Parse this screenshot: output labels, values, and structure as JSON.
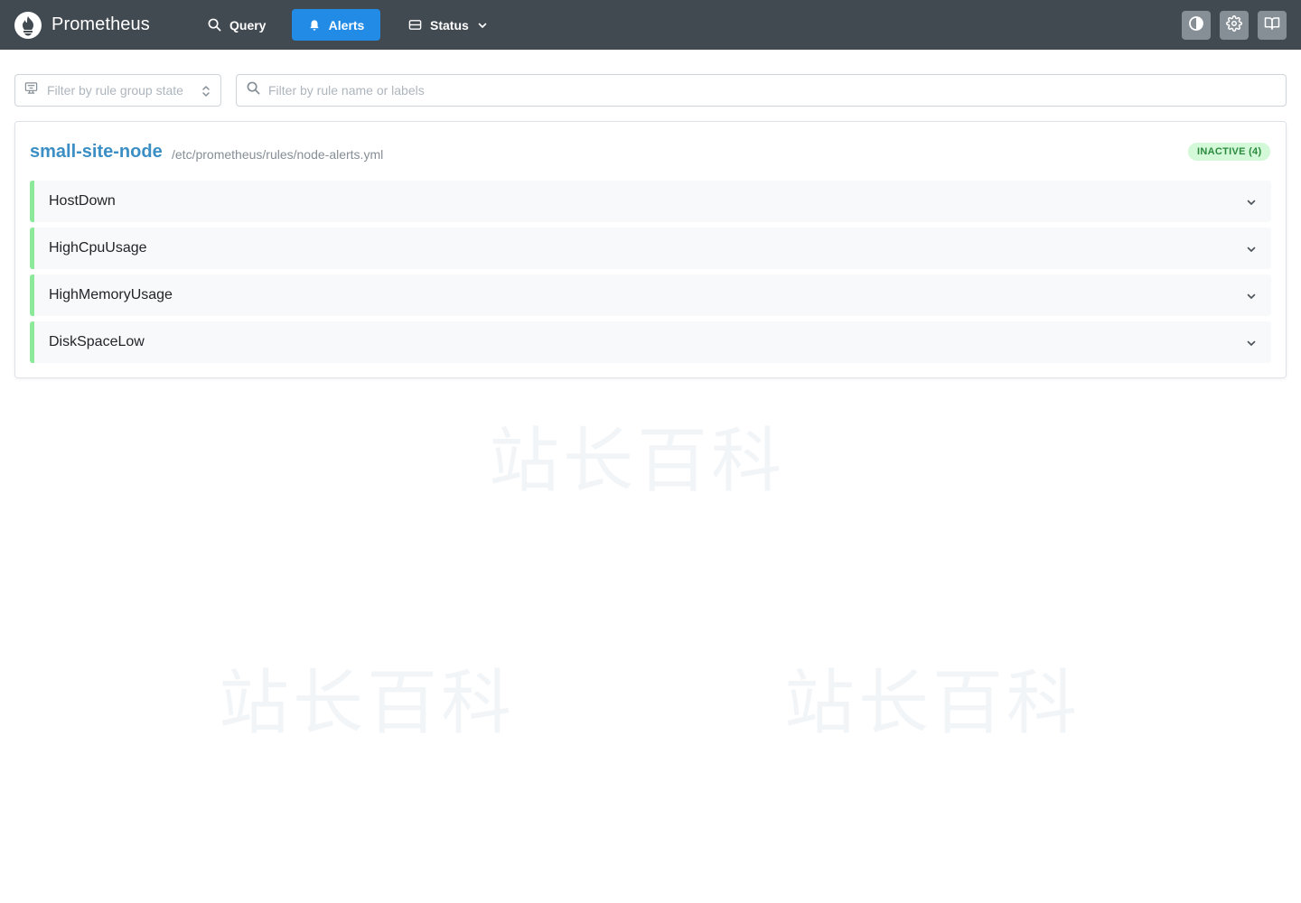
{
  "header": {
    "brand": "Prometheus",
    "nav": {
      "query_label": "Query",
      "alerts_label": "Alerts",
      "status_label": "Status"
    },
    "icons": [
      "contrast-icon",
      "gear-icon",
      "book-icon"
    ]
  },
  "filters": {
    "state_placeholder": "Filter by rule group state",
    "search_placeholder": "Filter by rule name or labels"
  },
  "rule_group": {
    "name": "small-site-node",
    "file": "/etc/prometheus/rules/node-alerts.yml",
    "badge": "INACTIVE (4)",
    "rules": [
      {
        "name": "HostDown"
      },
      {
        "name": "HighCpuUsage"
      },
      {
        "name": "HighMemoryUsage"
      },
      {
        "name": "DiskSpaceLow"
      }
    ]
  },
  "watermark": "站长百科",
  "colors": {
    "navbar": "#414951",
    "accent": "#228be6",
    "group_link": "#3b8fc4",
    "inactive_bar": "#8ce99a",
    "badge_bg": "#d3f9d8",
    "badge_text": "#2b8a3e"
  }
}
